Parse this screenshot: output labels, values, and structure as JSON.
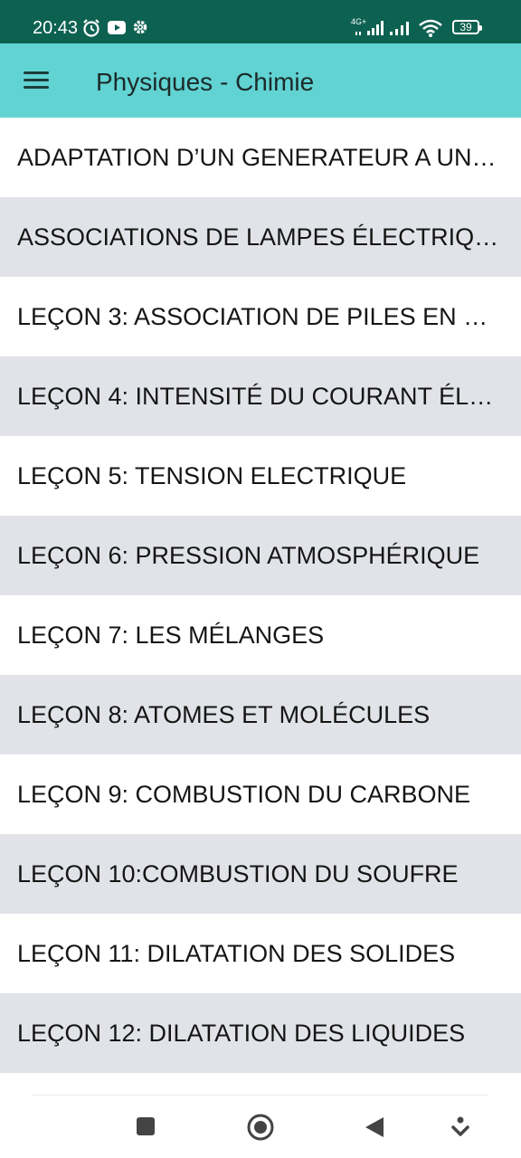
{
  "status_bar": {
    "time": "20:43",
    "network": "4G+",
    "battery": "39",
    "icons": [
      "alarm-icon",
      "youtube-icon",
      "settings-icon",
      "signal-icon",
      "signal-icon",
      "wifi-icon",
      "battery-icon"
    ]
  },
  "app_bar": {
    "title": "Physiques - Chimie",
    "menu_icon": "hamburger-menu-icon",
    "color": "#60d3d2"
  },
  "lessons": [
    {
      "label": "ADAPTATION D’UN GENERATEUR A UN…"
    },
    {
      "label": "ASSOCIATIONS DE LAMPES ÉLECTRIQ…"
    },
    {
      "label": "LEÇON 3: ASSOCIATION DE PILES EN S…"
    },
    {
      "label": "LEÇON 4: INTENSITÉ DU COURANT ÉLE…"
    },
    {
      "label": "LEÇON 5: TENSION ELECTRIQUE"
    },
    {
      "label": "LEÇON 6: PRESSION ATMOSPHÉRIQUE"
    },
    {
      "label": "LEÇON 7: LES MÉLANGES"
    },
    {
      "label": "LEÇON 8: ATOMES ET MOLÉCULES"
    },
    {
      "label": "LEÇON 9: COMBUSTION DU CARBONE"
    },
    {
      "label": "LEÇON 10:COMBUSTION DU SOUFRE"
    },
    {
      "label": "LEÇON 11: DILATATION DES SOLIDES"
    },
    {
      "label": "LEÇON 12: DILATATION DES LIQUIDES"
    }
  ],
  "colors": {
    "status_bar": "#0d6150",
    "row_alt": "#e1e3e8"
  },
  "nav_bar": {
    "icons": [
      "recents-square-icon",
      "home-circle-icon",
      "back-triangle-icon",
      "assistant-icon"
    ]
  }
}
